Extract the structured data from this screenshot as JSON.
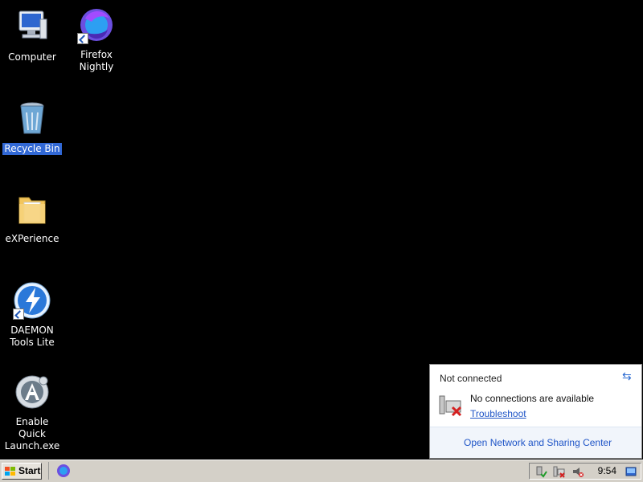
{
  "desktop": {
    "icons": [
      {
        "label": "Computer"
      },
      {
        "label": "Firefox\nNightly"
      },
      {
        "label": "Recycle Bin"
      },
      {
        "label": "eXPerience"
      },
      {
        "label": "DAEMON\nTools Lite"
      },
      {
        "label": "Enable Quick\nLaunch.exe"
      }
    ]
  },
  "network_popup": {
    "title": "Not connected",
    "message": "No connections are available",
    "troubleshoot": "Troubleshoot",
    "open_center": "Open Network and Sharing Center"
  },
  "taskbar": {
    "start_label": "Start",
    "clock": "9:54"
  }
}
